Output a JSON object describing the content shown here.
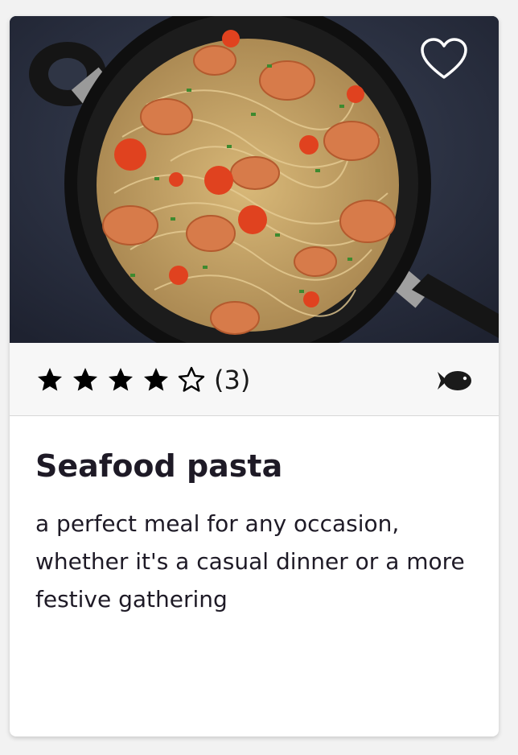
{
  "card": {
    "title": "Seafood pasta",
    "description": "a perfect meal for any occasion, whether it's a casual dinner or a more festive gathering",
    "rating": {
      "filled": 4,
      "total": 5,
      "count_text": "(3)"
    },
    "favorite_icon": "heart-outline-icon",
    "category_icon": "fish-icon"
  },
  "colors": {
    "text": "#1e1a26",
    "meta_bg": "#f7f7f7",
    "card_bg": "#ffffff",
    "page_bg": "#f2f2f2"
  }
}
